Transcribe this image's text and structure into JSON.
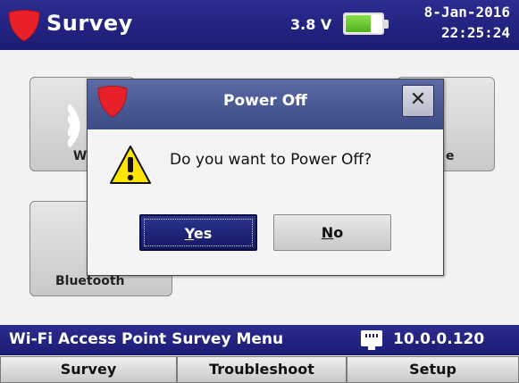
{
  "header": {
    "title": "Survey",
    "voltage": "3.8 V",
    "battery_level_fraction": 0.72,
    "date": "8-Jan-2016",
    "time": "22:25:24",
    "logo_icon": "shield-logo-icon"
  },
  "tiles": [
    {
      "label": "Wi",
      "icon": "wifi-icon"
    },
    {
      "label": "e",
      "icon": ""
    },
    {
      "label": "Bluetooth",
      "icon": ""
    }
  ],
  "dialog": {
    "title": "Power Off",
    "message": "Do you want to Power Off?",
    "close_symbol": "✕",
    "yes_mnemonic": "Y",
    "yes_rest": "es",
    "no_mnemonic": "N",
    "no_rest": "o",
    "warning_icon": "warning-icon"
  },
  "status": {
    "menu_label": "Wi-Fi Access Point Survey Menu",
    "ip_address": "10.0.0.120",
    "network_icon": "ethernet-icon"
  },
  "tabs": [
    {
      "label": "Survey"
    },
    {
      "label": "Troubleshoot"
    },
    {
      "label": "Setup"
    }
  ],
  "colors": {
    "bar_blue": "#1b1c74",
    "logo_red": "#e8202a",
    "battery_green": "#4fb11f",
    "dialog_title_blue": "#3c4a86",
    "warning_yellow": "#ffe600"
  }
}
